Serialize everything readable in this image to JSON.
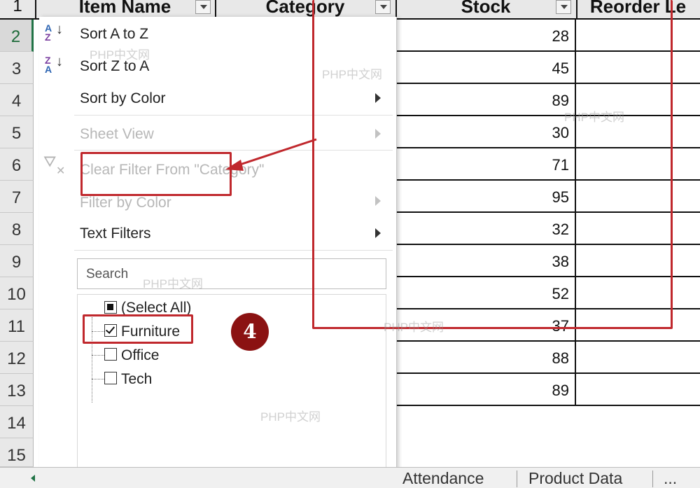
{
  "columns": {
    "item_name": "Item Name",
    "category": "Category",
    "stock": "Stock",
    "reorder": "Reorder Le"
  },
  "row_numbers": [
    "1",
    "2",
    "3",
    "4",
    "5",
    "6",
    "7",
    "8",
    "9",
    "10",
    "11",
    "12",
    "13",
    "14",
    "15"
  ],
  "stock_values": [
    "28",
    "45",
    "89",
    "30",
    "71",
    "95",
    "32",
    "38",
    "52",
    "37",
    "88",
    "89"
  ],
  "menu": {
    "sort_az": "Sort A to Z",
    "sort_za": "Sort Z to A",
    "sort_color": "Sort by Color",
    "sheet_view": "Sheet View",
    "clear_filter": "Clear Filter From \"Category\"",
    "filter_color": "Filter by Color",
    "text_filters": "Text Filters"
  },
  "search": {
    "placeholder": "Search"
  },
  "filter_values": {
    "select_all": "(Select All)",
    "furniture": "Furniture",
    "office": "Office",
    "tech": "Tech"
  },
  "step_badge": "4",
  "watermark": "PHP中文网",
  "sheet_tabs": {
    "attendance": "Attendance",
    "product_data": "Product Data",
    "more": "..."
  },
  "colors": {
    "annotation_red": "#c0282d",
    "badge_red": "#8b1212",
    "excel_green": "#217346"
  },
  "icons": {
    "sort_az": "sort-ascending-icon",
    "sort_za": "sort-descending-icon",
    "clear_filter": "clear-filter-icon"
  }
}
